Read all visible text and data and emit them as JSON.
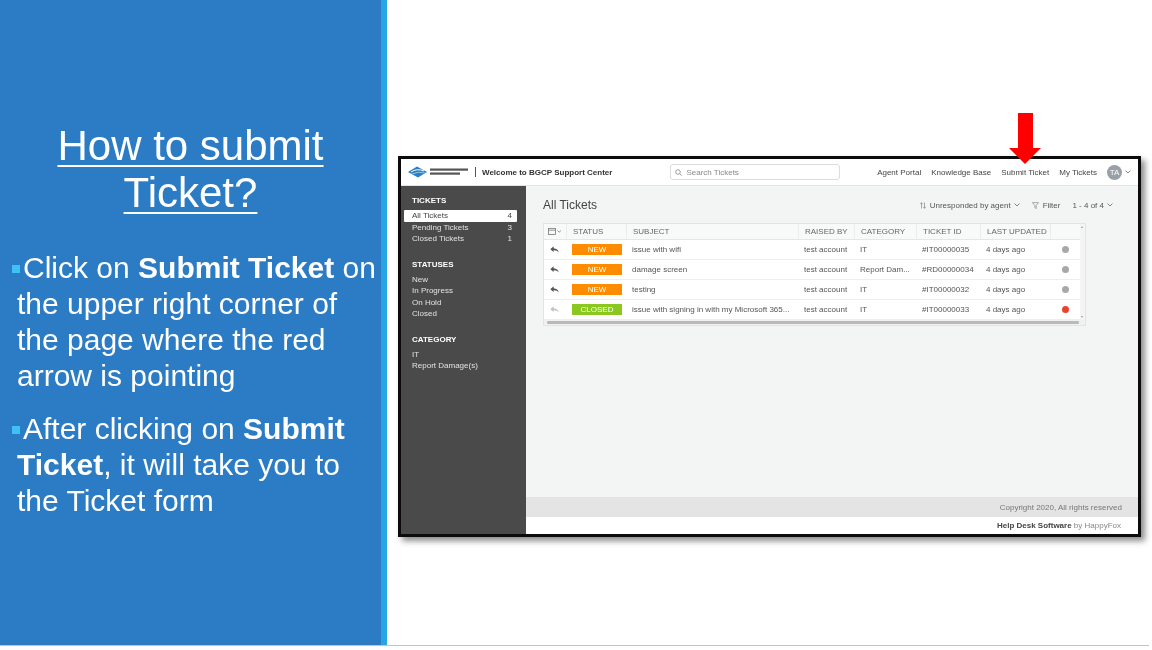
{
  "slide": {
    "title": "How to submit Ticket?",
    "bullets": [
      "Click on **Submit Ticket** on the upper right corner of the page where the red arrow is pointing",
      "After clicking on **Submit Ticket**, it will take you to the Ticket form"
    ]
  },
  "screenshot": {
    "header": {
      "title": "Welcome to BGCP Support Center",
      "search": {
        "placeholder": "Search Tickets"
      },
      "nav_links": [
        "Agent Portal",
        "Knowledge Base",
        "Submit Ticket",
        "My Tickets"
      ],
      "avatar": "TA"
    },
    "sidebar": {
      "sections": [
        {
          "heading": "TICKETS",
          "items": [
            {
              "label": "All Tickets",
              "count": "4",
              "selected": true
            },
            {
              "label": "Pending Tickets",
              "count": "3",
              "selected": false
            },
            {
              "label": "Closed Tickets",
              "count": "1",
              "selected": false
            }
          ]
        },
        {
          "heading": "STATUSES",
          "items": [
            {
              "label": "New",
              "selected": false
            },
            {
              "label": "In Progress",
              "selected": false
            },
            {
              "label": "On Hold",
              "selected": false
            },
            {
              "label": "Closed",
              "selected": false
            }
          ]
        },
        {
          "heading": "CATEGORY",
          "items": [
            {
              "label": "IT",
              "selected": false
            },
            {
              "label": "Report Damage(s)",
              "selected": false
            }
          ]
        }
      ]
    },
    "main": {
      "heading": "All Tickets",
      "sort": "Unresponded by agent",
      "filter": "Filter",
      "pagination": "1 - 4 of 4",
      "table": {
        "columns": [
          "STATUS",
          "SUBJECT",
          "RAISED BY",
          "CATEGORY",
          "TICKET ID",
          "LAST UPDATED"
        ],
        "rows": [
          {
            "status": {
              "label": "NEW",
              "kind": "new"
            },
            "subject": "issue with wifi",
            "raised_by": "test account",
            "category": "IT",
            "ticket_id": "#IT00000035",
            "last_updated": "4 days ago",
            "color": "#a8a8a8"
          },
          {
            "status": {
              "label": "NEW",
              "kind": "new"
            },
            "subject": "damage screen",
            "raised_by": "test account",
            "category": "Report Dam...",
            "ticket_id": "#RD00000034",
            "last_updated": "4 days ago",
            "color": "#a8a8a8"
          },
          {
            "status": {
              "label": "NEW",
              "kind": "new"
            },
            "subject": "testing",
            "raised_by": "test account",
            "category": "IT",
            "ticket_id": "#IT00000032",
            "last_updated": "4 days ago",
            "color": "#a8a8a8"
          },
          {
            "status": {
              "label": "CLOSED",
              "kind": "closed"
            },
            "subject": "issue with signing in with my Microsoft 365...",
            "raised_by": "test account",
            "category": "IT",
            "ticket_id": "#IT00000033",
            "last_updated": "4 days ago",
            "color": "#e8432d"
          }
        ]
      }
    },
    "footer": {
      "copyright": "Copyright 2020, All rights reserved",
      "credit": "**Help Desk Software** by HappyFox"
    }
  }
}
